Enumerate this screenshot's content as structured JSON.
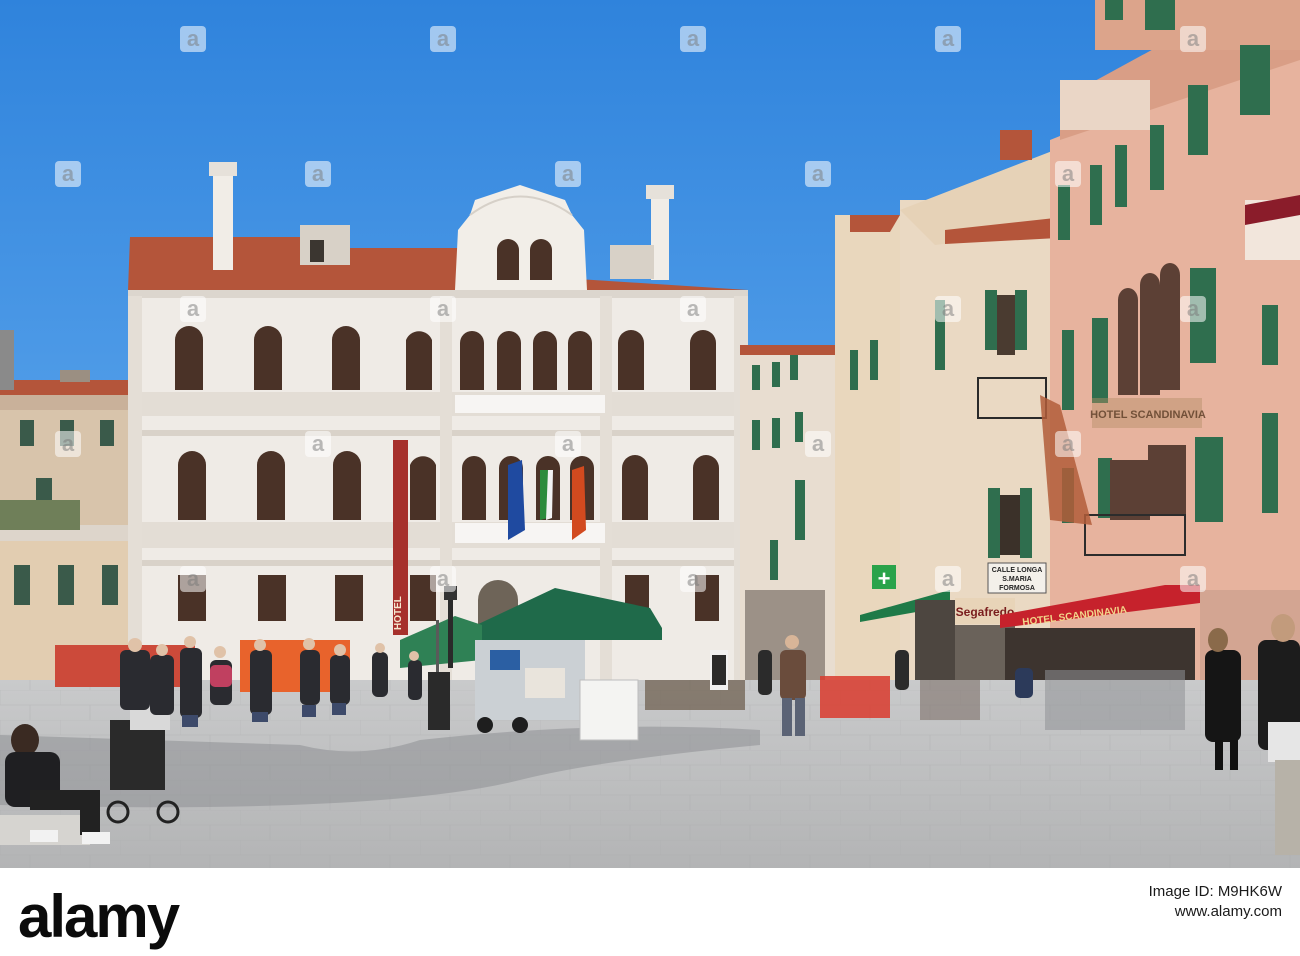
{
  "scene": {
    "sky_color": "#3d8fe0",
    "pavement_color": "#bcbdbe",
    "palazzo_color": "#efebe6",
    "roof_color": "#b4553a",
    "shutter_color": "#2f6e4e",
    "pink_building_color": "#e7b39e",
    "awning_color": "#c6222c"
  },
  "signs": {
    "hotel_vertical": "HOTEL",
    "hotel_scandinavia": "HOTEL SCANDINAVIA",
    "sagafredo": "Segafredo",
    "street_sign_line1": "CALLE LONGA",
    "street_sign_line2": "S.MARIA",
    "street_sign_line3": "FORMOSA",
    "pharmacy_cross": "+"
  },
  "footer": {
    "brand": "alamy",
    "image_id": "Image ID: M9HK6W",
    "site": "www.alamy.com"
  },
  "watermark": {
    "glyph": "a"
  }
}
